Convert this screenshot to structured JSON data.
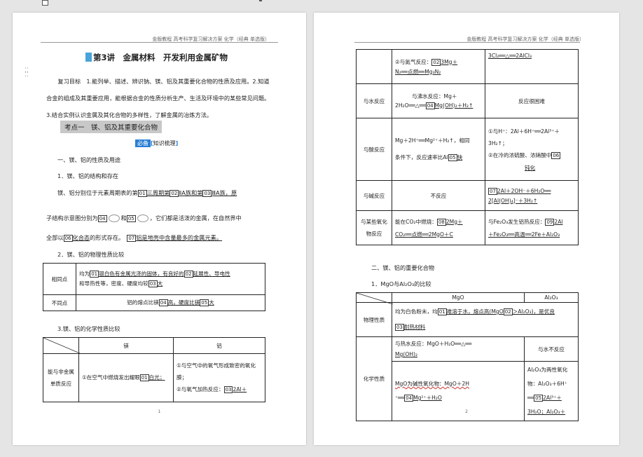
{
  "header_text": "金版教程 高考科学复习解决方案 化学（经典 单选版）",
  "page1": {
    "title": "第3讲　金属材料　开发利用金属矿物",
    "objectives": "复习目标　1.能列举、描述、辨识钠、镁、铝及其重要化合物的性质及应用。2.知道合金的组成及其重要应用，能根据合金的性质分析生产、生活及环境中的某些常见问题。3.结合实例认识金属及其化合物的多样性，了解金属的冶炼方法。",
    "section": "考点一　镁、铝及其重要化合物",
    "badge": "必备",
    "badge2": "知识梳理",
    "h1": "一、镁、铝的性质及用途",
    "h2": "1．镁、铝的结构和存在",
    "s1a": "镁、铝分别位于元素周期表的第",
    "b01": "01",
    "s1b": "三周期第",
    "b02": "02",
    "s1c": "ⅡA族和第",
    "b03": "03",
    "s1d": "ⅢA族，原",
    "s2a": "子结构示意图分别为",
    "b04": "04",
    "s2b": "和",
    "b05": "05",
    "s2c": "，它们都是活泼的金属，在自然界中",
    "s3a": "全部以",
    "b06": "06",
    "s3b": "化合态",
    "s3c": "的形式存在。",
    "b07": "07",
    "s3d": "铝是地壳中含量最多的金属元素。",
    "h3": "2．镁、铝的物理性质比较",
    "phys": {
      "r1": "相同点",
      "r1c_a": "均为",
      "b01": "01",
      "r1c_b": "银白色有金属光泽的固体，有良好的",
      "b02": "02",
      "r1c_c": "延展性、导电性",
      "r1c_d": "和导热性等，密度、硬度均较",
      "b03": "03",
      "r1c_e": "大",
      "r2": "不同点",
      "r2c_a": "铝的熔点比镁",
      "b04": "04",
      "r2c_b": "高，硬度比镁",
      "b05": "05",
      "r2c_c": "大"
    },
    "h4": "3.镁、铝的化学性质比较",
    "chem": {
      "hMg": "镁",
      "hAl": "铝",
      "row": "能与非金属单质反应",
      "mg": "①在空气中燃烧发出耀眼",
      "b01": "01",
      "mg2": "白光；",
      "al1": "①与空气中的氧气形成致密的氧化膜；",
      "al2": "②与氧气加热反应：",
      "b03": "03",
      "al3": "2Al＋"
    },
    "page_num": "1"
  },
  "page2": {
    "r1": {
      "mg_a": "②与氮气反应：",
      "b02": "02",
      "mg_b": "3Mg＋",
      "mg_c": "N₂══点燃══Mg₃N₂",
      "al": "3Cl₂══△══2AlCl₃"
    },
    "r2": {
      "label": "与水反应",
      "mg_a": "与沸水反应：Mg＋",
      "mg_b": "2H₂O══△══",
      "b04": "04",
      "mg_c": "Mg(OH)₂＋H₂↑",
      "al": "反应很困难"
    },
    "r3": {
      "label": "与酸反应",
      "mg_a": "Mg＋2H⁺══Mg²⁺＋H₂↑，相同",
      "mg_b": "条件下，反应速率比Al",
      "b05": "05",
      "mg_c": "快",
      "al_a": "①与H⁺：2Al＋6H⁺══2Al³⁺＋",
      "al_b": "3H₂↑；",
      "al_c": "②在冷的浓硫酸、浓硝酸中",
      "b06": "06",
      "al_d": "钝化"
    },
    "r4": {
      "label": "与碱反应",
      "mg": "不反应",
      "b07": "07",
      "al_a": "2Al＋2OH⁻＋6H₂O══",
      "al_b": "2[Al(OH)₄]⁻＋3H₂↑"
    },
    "r5": {
      "label": "与某些氧化物反应",
      "mg_a": "能在CO₂中燃烧：",
      "b08": "08",
      "mg_b": "2Mg＋",
      "mg_c": "CO₂══点燃══2MgO＋C",
      "al_a": "与Fe₂O₃发生铝热反应：",
      "b09": "09",
      "al_b": "2Al",
      "al_c": "＋Fe₂O₃══高温══2Fe＋Al₂O₃"
    },
    "h1": "二、镁、铝的重要化合物",
    "h2": "1．MgO与Al₂O₃的比较",
    "t2": {
      "hMgO": "MgO",
      "hAl2O3": "Al₂O₃",
      "phys_label": "物理性质",
      "phys_a": "均为白色粉末，均",
      "b01": "01",
      "phys_b": "难溶于水，熔点高(MgO",
      "b02": "02",
      "phys_c": "＞Al₂O₃)，是优良",
      "b03": "03",
      "phys_d": "耐热材料",
      "chem_label": "化学性质",
      "c1_a": "与热水反应：MgO＋H₂O══△══",
      "c1_b": "Mg(OH)₂",
      "c1_al": "与水不反应",
      "c2_a": "MgO为碱性氧化物：MgO＋2H",
      "c2_b": "⁺══",
      "b04": "04",
      "c2_c": "Mg²⁺＋H₂O",
      "c2_al_a": "Al₂O₃为两性氧化物：Al₂O₃＋6H⁺",
      "c2_al_b": "══",
      "b05": "05",
      "c2_al_c": "2Al³⁺＋3H₂O；Al₂O₃＋"
    },
    "page_num": "2"
  }
}
